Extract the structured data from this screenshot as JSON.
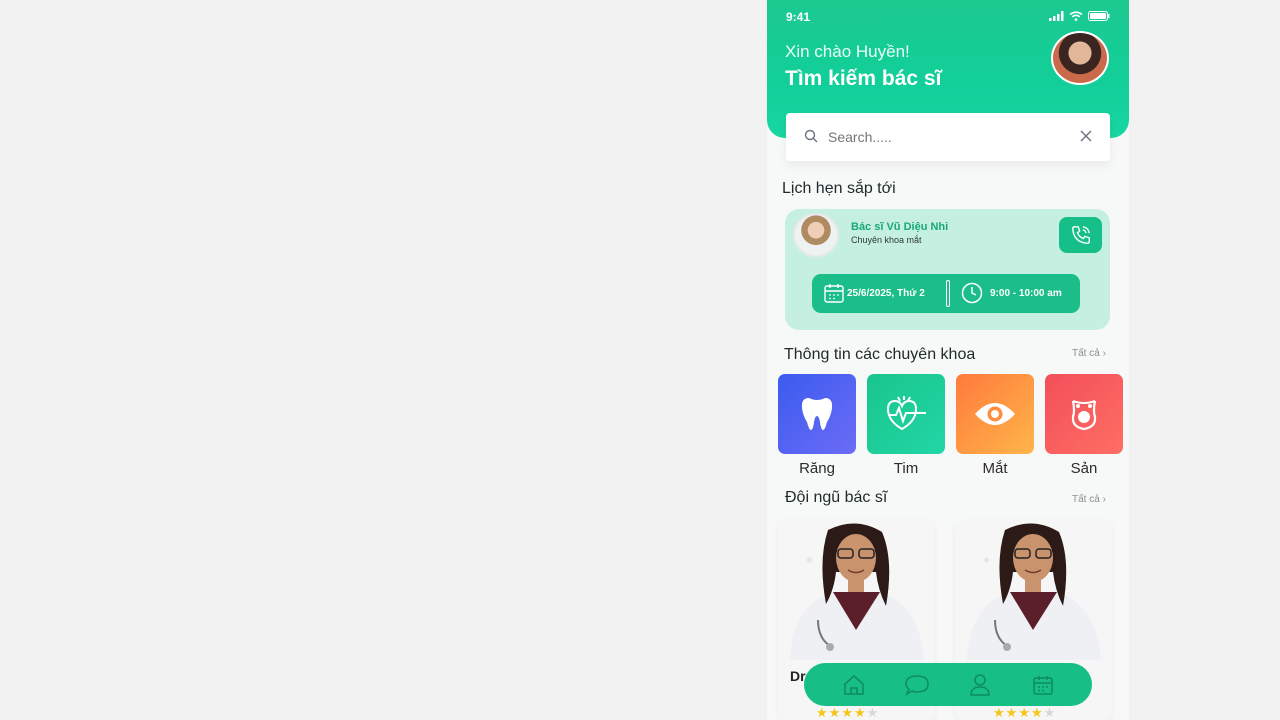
{
  "status": {
    "time": "9:41"
  },
  "header": {
    "greeting": "Xin chào Huyền!",
    "title": "Tìm kiếm bác sĩ"
  },
  "search": {
    "placeholder": "Search....."
  },
  "appointments": {
    "heading": "Lịch hẹn sắp tới",
    "doctor_name": "Bác sĩ Vũ Diệu Nhi",
    "doctor_specialty": "Chuyên khoa mắt",
    "date": "25/6/2025, Thứ 2",
    "time": "9:00 - 10:00 am"
  },
  "specialties": {
    "heading": "Thông tin các chuyên khoa",
    "see_all": "Tất cả ›",
    "items": [
      {
        "label": "Răng",
        "icon": "tooth-icon",
        "color_from": "#3b5bef",
        "color_to": "#6c6cf6"
      },
      {
        "label": "Tim",
        "icon": "heart-pulse-icon",
        "color_from": "#19c58c",
        "color_to": "#22d6a6"
      },
      {
        "label": "Mắt",
        "icon": "eye-icon",
        "color_from": "#ff7a3c",
        "color_to": "#ffb54a"
      },
      {
        "label": "Sản",
        "icon": "pregnancy-icon",
        "color_from": "#f24f5a",
        "color_to": "#ff6e63"
      }
    ]
  },
  "doctors": {
    "heading": "Đội ngũ bác sĩ",
    "see_all": "Tất cả ›",
    "items": [
      {
        "name": "Dr",
        "rating": 4
      },
      {
        "name": "",
        "rating": 4
      }
    ]
  },
  "tabbar": {
    "tabs": [
      "home-icon",
      "chat-icon",
      "profile-icon",
      "calendar-icon"
    ]
  },
  "colors": {
    "primary": "#17bf86",
    "appointment_bg": "#c5efe1"
  }
}
